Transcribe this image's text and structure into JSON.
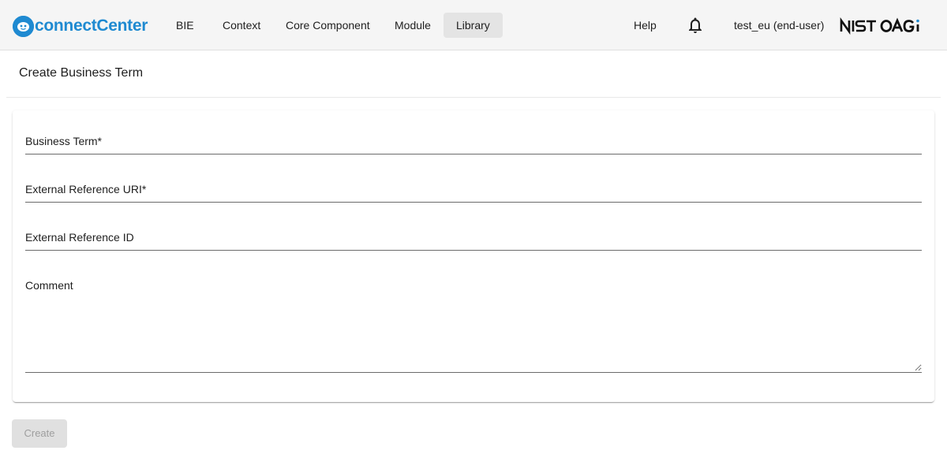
{
  "app": {
    "logo_text": "connectCenter",
    "brand_color": "#1f8ad1",
    "right_logo": "NIST OAGi"
  },
  "nav": {
    "items": [
      {
        "label": "BIE"
      },
      {
        "label": "Context"
      },
      {
        "label": "Core Component"
      },
      {
        "label": "Module"
      },
      {
        "label": "Library",
        "active": true
      }
    ],
    "help_label": "Help",
    "notification_icon": "bell-icon",
    "user_label": "test_eu (end-user)"
  },
  "page": {
    "title": "Create Business Term"
  },
  "form": {
    "business_term": {
      "label": "Business Term*",
      "value": ""
    },
    "external_reference_uri": {
      "label": "External Reference URI*",
      "value": ""
    },
    "external_reference_id": {
      "label": "External Reference ID",
      "value": ""
    },
    "comment": {
      "label": "Comment",
      "value": ""
    }
  },
  "actions": {
    "create_label": "Create",
    "create_disabled": true
  }
}
